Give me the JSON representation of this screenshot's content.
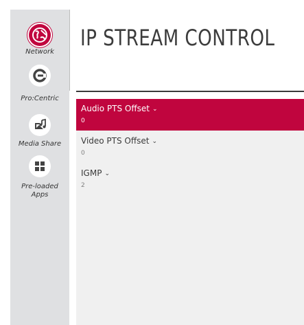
{
  "sidebar": {
    "items": [
      {
        "label": "Network",
        "icon": "globe-icon",
        "active": true
      },
      {
        "label": "Pro:Centric",
        "icon": "procentric-icon",
        "active": false
      },
      {
        "label": "Media Share",
        "icon": "media-share-icon",
        "active": false
      },
      {
        "label": "Pre-loaded Apps",
        "icon": "apps-grid-icon",
        "active": false
      }
    ]
  },
  "main": {
    "title": "IP STREAM CONTROL",
    "settings": [
      {
        "label": "Audio PTS Offset",
        "value": "0",
        "selected": true
      },
      {
        "label": "Video PTS Offset",
        "value": "0",
        "selected": false
      },
      {
        "label": "IGMP",
        "value": "2",
        "selected": false
      }
    ],
    "chevron": "⌄"
  },
  "colors": {
    "accent": "#c0053e",
    "sidebar_bg": "#dfe0e2",
    "content_bg": "#f0f0f0",
    "title_text": "#3c3c3c"
  }
}
